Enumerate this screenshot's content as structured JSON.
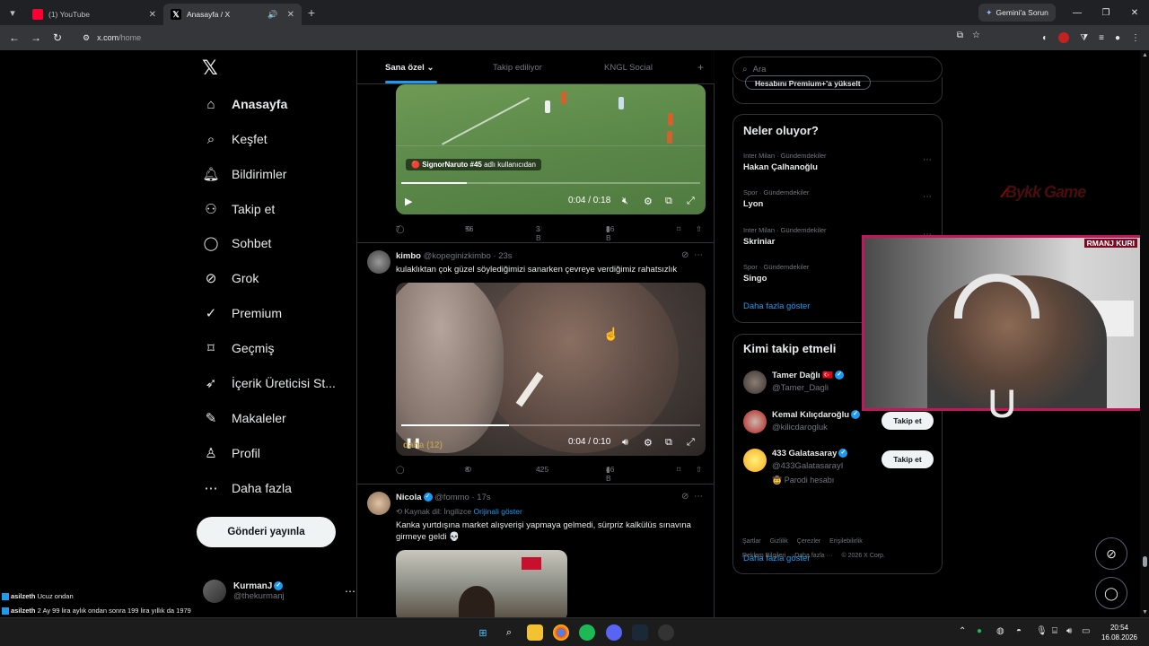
{
  "browser": {
    "tabs": [
      {
        "title": "(1) YouTube"
      },
      {
        "title": "Anasayfa / X"
      }
    ],
    "gemini_label": "Gemini'a Sorun",
    "url_domain": "x.com",
    "url_path": "/home"
  },
  "nav": {
    "items": [
      {
        "label": "Anasayfa",
        "icon": "home-icon"
      },
      {
        "label": "Keşfet",
        "icon": "search-icon"
      },
      {
        "label": "Bildirimler",
        "icon": "bell-icon"
      },
      {
        "label": "Takip et",
        "icon": "follow-icon"
      },
      {
        "label": "Sohbet",
        "icon": "chat-icon"
      },
      {
        "label": "Grok",
        "icon": "grok-icon"
      },
      {
        "label": "Premium",
        "icon": "premium-icon"
      },
      {
        "label": "Geçmiş",
        "icon": "bookmark-icon"
      },
      {
        "label": "İçerik Üreticisi St...",
        "icon": "rocket-icon"
      },
      {
        "label": "Makaleler",
        "icon": "article-icon"
      },
      {
        "label": "Profil",
        "icon": "profile-icon"
      },
      {
        "label": "Daha fazla",
        "icon": "more-icon"
      }
    ],
    "post_button": "Gönderi yayınla",
    "account_name": "KurmanJ",
    "account_handle": "@thekurmanj"
  },
  "timeline": {
    "tabs": [
      "Sana özel",
      "Takip ediliyor",
      "KNGL Social"
    ],
    "tweet1": {
      "user_tag_name": "SignorNaruto #45",
      "user_tag_suffix": " adlı kullanıcıdan",
      "time": "0:04 / 0:18",
      "progress": 0.22,
      "replies": "7",
      "retweets": "56",
      "likes": "3 B",
      "views": "86 B"
    },
    "tweet2": {
      "name": "kimbo",
      "handle": "@kopeginizkimbo",
      "age": "23s",
      "text": "kulaklıktan çok güzel söylediğimizi sanarken çevreye verdiğimiz rahatsızlık",
      "time": "0:04 / 0:10",
      "progress": 0.36,
      "overlay_text": "daha (12)",
      "replies": "",
      "retweets": "8",
      "likes": "425",
      "views": "46 B"
    },
    "tweet3": {
      "name": "Nicola",
      "handle": "@fommo",
      "age": "17s",
      "source_lang": "Kaynak dil: İngilizce",
      "show_original": "Orijinali göster",
      "text": "Kanka yurtdışına market alışverişi yapmaya gelmedi, sürpriz kalkülüs sınavına girmeye geldi 💀"
    }
  },
  "right": {
    "search_placeholder": "Ara",
    "premium_pill": "Hesabını Premium+'a yükselt",
    "trends_title": "Neler oluyor?",
    "trends": [
      {
        "context": "Inter Milan · Gündemdekiler",
        "name": "Hakan Çalhanoğlu"
      },
      {
        "context": "Spor · Gündemdekiler",
        "name": "Lyon"
      },
      {
        "context": "Inter Milan · Gündemdekiler",
        "name": "Skriniar"
      },
      {
        "context": "Spor · Gündemdekiler",
        "name": "Singo"
      }
    ],
    "show_more": "Daha fazla göster",
    "who_title": "Kimi takip etmeli",
    "who": [
      {
        "name": "Tamer Dağlı 🇹🇷",
        "handle": "@Tamer_Dagli",
        "button": ""
      },
      {
        "name": "Kemal Kılıçdaroğlu",
        "handle": "@kilicdarogluk",
        "button": "Takip et"
      },
      {
        "name": "433 Galatasaray",
        "handle": "@433GalatasarayI",
        "extra": "🤠 Parodi hesabı",
        "button": "Takip et"
      }
    ],
    "footer": [
      "Şartlar",
      "Gizlilik",
      "Çerezler",
      "Erişilebilirlik",
      "Reklam Bilgileri",
      "Daha fazla ···",
      "© 2026 X Corp."
    ]
  },
  "overlay": {
    "ticker": "RMANJ  KURI",
    "brand": "Bykk Game",
    "chat": [
      {
        "user": "asilzeth",
        "message": "Ucuz ondan"
      },
      {
        "user": "asilzeth",
        "message": "2 Ay 99 lira aylık ondan sonra 199 lira yıllık da 1979"
      }
    ]
  },
  "taskbar": {
    "time": "20:54",
    "date": "16.08.2026"
  }
}
